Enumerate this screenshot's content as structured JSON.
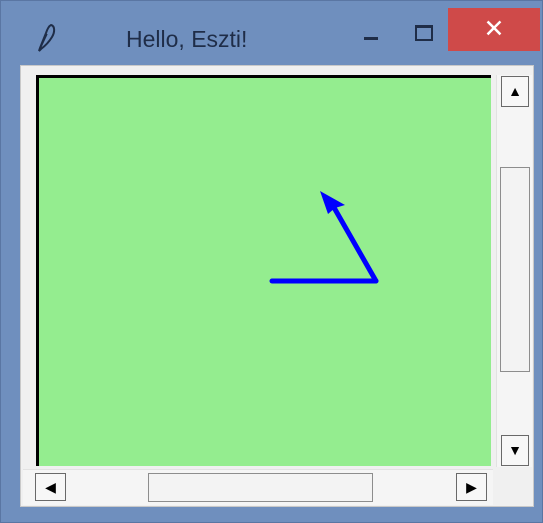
{
  "window": {
    "title": "Hello, Eszti!",
    "icon": "feather-icon",
    "close_glyph": "✕",
    "close_color": "#cf4a49",
    "frame_color": "#6f8fbe"
  },
  "canvas": {
    "background": "#94ed8f",
    "stroke_color": "#0000ff"
  },
  "scrollbars": {
    "up_glyph": "▲",
    "down_glyph": "▼",
    "left_glyph": "◀",
    "right_glyph": "▶"
  }
}
